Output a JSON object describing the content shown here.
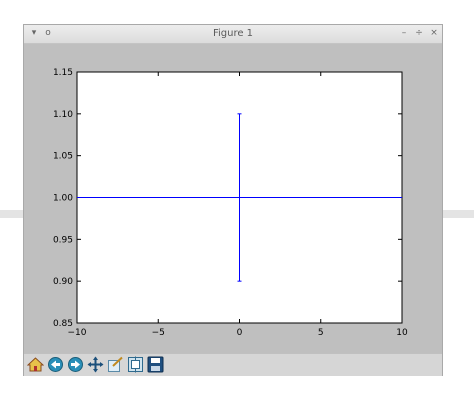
{
  "window": {
    "title": "Figure 1",
    "menu_icon": "▾",
    "pin_icon": "o",
    "minimize_icon": "–",
    "maximize_icon": "÷",
    "close_icon": "×"
  },
  "toolbar": {
    "tools": [
      {
        "name": "home-icon"
      },
      {
        "name": "back-arrow-icon"
      },
      {
        "name": "forward-arrow-icon"
      },
      {
        "name": "pan-icon"
      },
      {
        "name": "zoom-icon"
      },
      {
        "name": "subplots-icon"
      },
      {
        "name": "save-icon"
      }
    ]
  },
  "chart_data": {
    "type": "line",
    "title": "",
    "xlabel": "",
    "ylabel": "",
    "xlim": [
      -10,
      10
    ],
    "ylim": [
      0.85,
      1.15
    ],
    "x_ticks": [
      "−10",
      "−5",
      "0",
      "5",
      "10"
    ],
    "y_ticks": [
      "0.85",
      "0.90",
      "0.95",
      "1.00",
      "1.05",
      "1.10",
      "1.15"
    ],
    "series": [
      {
        "points": [
          [
            -10,
            1.0
          ],
          [
            10,
            1.0
          ]
        ],
        "color": "#0000ff"
      }
    ],
    "errorbar": {
      "x": 0,
      "y": 1.0,
      "low": 0.9,
      "high": 1.1,
      "color": "#0000ff"
    },
    "grid": false
  }
}
